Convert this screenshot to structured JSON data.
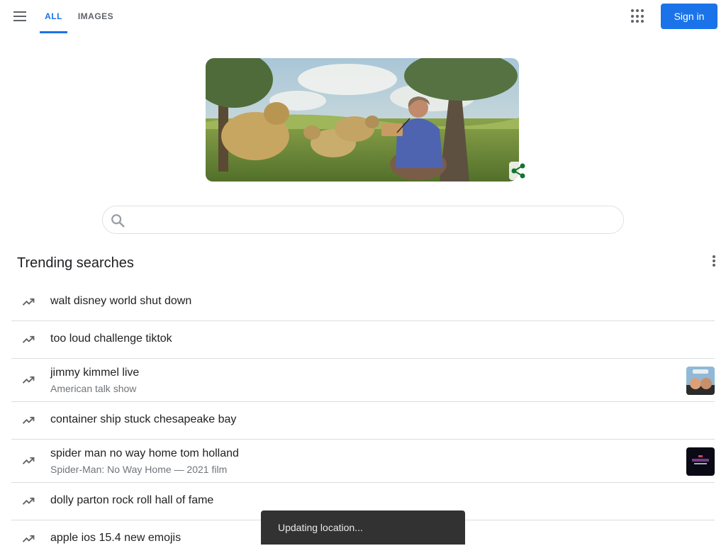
{
  "header": {
    "menu_icon": "hamburger-menu-icon",
    "tabs": [
      {
        "label": "ALL",
        "active": true
      },
      {
        "label": "IMAGES",
        "active": false
      }
    ],
    "apps_icon": "apps-grid-icon",
    "signin_label": "Sign in"
  },
  "doodle": {
    "share_icon": "share-icon",
    "share_color": "#137333"
  },
  "search": {
    "value": "",
    "placeholder": "",
    "icon": "search-icon"
  },
  "trending": {
    "title": "Trending searches",
    "more_icon": "more-vert-icon",
    "items": [
      {
        "query": "walt disney world shut down"
      },
      {
        "query": "too loud challenge tiktok"
      },
      {
        "query": "jimmy kimmel live",
        "subtitle": "American talk show"
      },
      {
        "query": "container ship stuck chesapeake bay"
      },
      {
        "query": "spider man no way home tom holland",
        "subtitle": "Spider-Man: No Way Home — 2021 film"
      },
      {
        "query": "dolly parton rock roll hall of fame"
      },
      {
        "query": "apple ios 15.4 new emojis"
      }
    ]
  },
  "toast": {
    "message": "Updating location..."
  },
  "colors": {
    "accent": "#1a73e8",
    "icon_gray": "#5f6368",
    "toast_bg": "#323232"
  }
}
